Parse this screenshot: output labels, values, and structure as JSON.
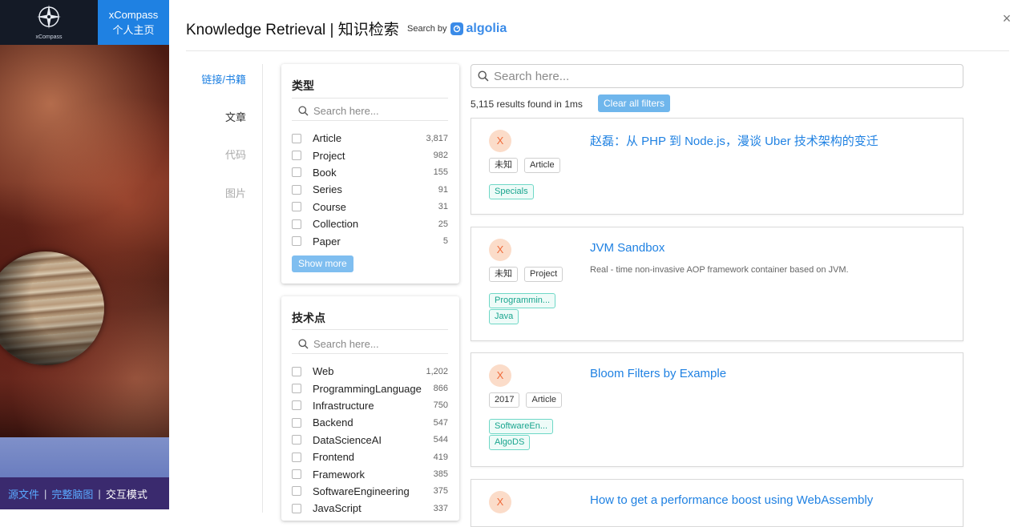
{
  "sidebar": {
    "logo_text": "xCompass",
    "site_name": "xCompass",
    "home_label": "个人主页",
    "footer": {
      "source_link": "源文件",
      "sep1": "|",
      "mindmap_link": "完整脑图",
      "sep2": "|",
      "interactive_label": "交互模式"
    }
  },
  "dialog": {
    "title": "Knowledge Retrieval | 知识检索",
    "search_by_label": "Search by",
    "provider": "algolia",
    "close_glyph": "×"
  },
  "categories": [
    {
      "label": "链接/书籍",
      "state": "active"
    },
    {
      "label": "文章",
      "state": "normal"
    },
    {
      "label": "代码",
      "state": "disabled"
    },
    {
      "label": "图片",
      "state": "disabled"
    }
  ],
  "facets": {
    "type": {
      "title": "类型",
      "search_placeholder": "Search here...",
      "items": [
        {
          "label": "Article",
          "count": "3,817"
        },
        {
          "label": "Project",
          "count": "982"
        },
        {
          "label": "Book",
          "count": "155"
        },
        {
          "label": "Series",
          "count": "91"
        },
        {
          "label": "Course",
          "count": "31"
        },
        {
          "label": "Collection",
          "count": "25"
        },
        {
          "label": "Paper",
          "count": "5"
        }
      ],
      "show_more_label": "Show more"
    },
    "tech": {
      "title": "技术点",
      "search_placeholder": "Search here...",
      "items": [
        {
          "label": "Web",
          "count": "1,202"
        },
        {
          "label": "ProgrammingLanguage",
          "count": "866"
        },
        {
          "label": "Infrastructure",
          "count": "750"
        },
        {
          "label": "Backend",
          "count": "547"
        },
        {
          "label": "DataScienceAI",
          "count": "544"
        },
        {
          "label": "Frontend",
          "count": "419"
        },
        {
          "label": "Framework",
          "count": "385"
        },
        {
          "label": "SoftwareEngineering",
          "count": "375"
        },
        {
          "label": "JavaScript",
          "count": "337"
        }
      ]
    }
  },
  "results": {
    "search_placeholder": "Search here...",
    "stats": "5,115 results found in 1ms",
    "clear_label": "Clear all filters",
    "hits": [
      {
        "avatar": "X",
        "year": "未知",
        "type": "Article",
        "tags": [
          "Specials"
        ],
        "title": "赵磊：从 PHP 到 Node.js，漫谈 Uber 技术架构的变迁",
        "desc": ""
      },
      {
        "avatar": "X",
        "year": "未知",
        "type": "Project",
        "tags": [
          "Programmin...",
          "Java"
        ],
        "title": "JVM Sandbox",
        "desc": "Real - time non-invasive AOP framework container based on JVM."
      },
      {
        "avatar": "X",
        "year": "2017",
        "type": "Article",
        "tags": [
          "SoftwareEn...",
          "AlgoDS"
        ],
        "title": "Bloom Filters by Example",
        "desc": ""
      },
      {
        "avatar": "X",
        "year": "",
        "type": "",
        "tags": [],
        "title": "How to get a performance boost using WebAssembly",
        "desc": ""
      }
    ]
  },
  "colors": {
    "accent": "#1f81e2",
    "tag_text": "#18a58e",
    "avatar_bg": "#fbdcc9"
  },
  "icons": {
    "logo": "compass-icon",
    "search": "search-icon",
    "provider": "algolia-icon",
    "close": "close-icon"
  }
}
